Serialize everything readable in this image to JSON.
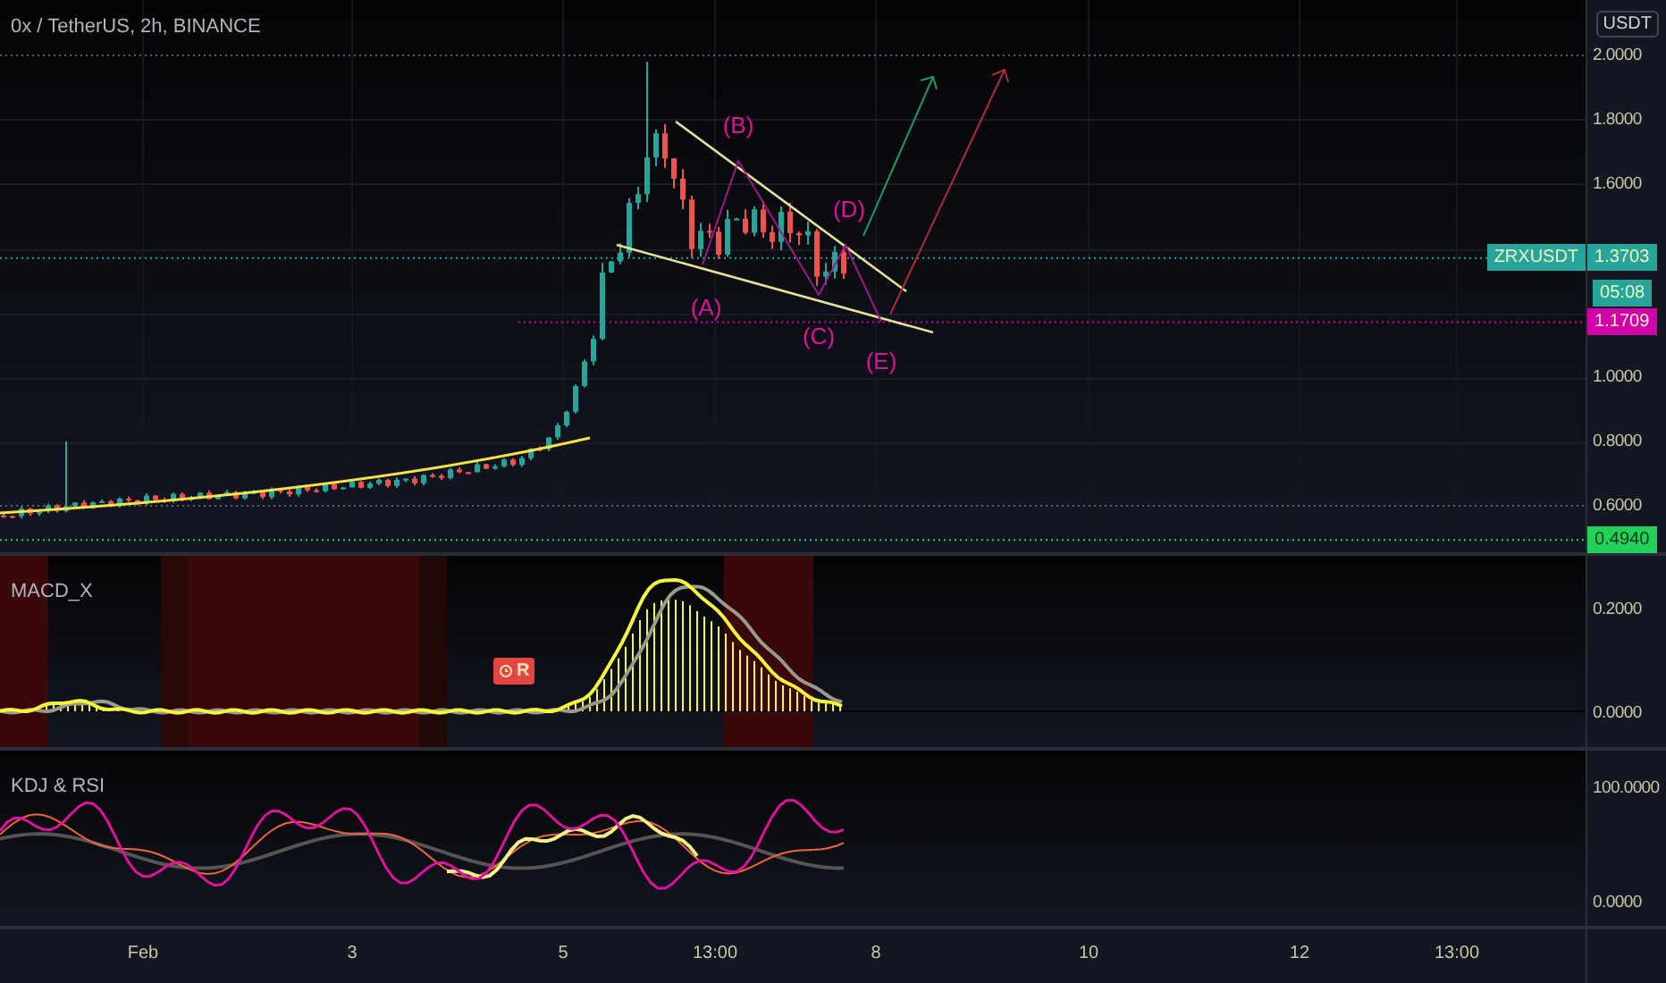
{
  "header": {
    "title": "0x / TetherUS, 2h, BINANCE"
  },
  "price_axis": {
    "currency": "USDT",
    "ticks": [
      "2.0000",
      "1.8000",
      "1.6000",
      "1.0000",
      "0.8000",
      "0.6000"
    ]
  },
  "price_labels": [
    {
      "kind": "symbol",
      "symbol": "ZRXUSDT",
      "value": "1.3703",
      "countdown": "05:08",
      "color": "#26a69a"
    },
    {
      "kind": "line",
      "value": "1.1709",
      "color": "#d100a8"
    },
    {
      "kind": "line",
      "value": "0.4940",
      "color": "#22d15a"
    }
  ],
  "wave_labels": [
    "(A)",
    "(B)",
    "(C)",
    "(D)",
    "(E)"
  ],
  "macd": {
    "title": "MACD_X",
    "ticks": [
      "0.2000",
      "0.0000"
    ],
    "signal_badge": "R"
  },
  "kdj": {
    "title": "KDJ & RSI",
    "ticks": [
      "100.0000",
      "0.0000"
    ]
  },
  "time_axis": [
    "Feb",
    "3",
    "5",
    "13:00",
    "8",
    "10",
    "12",
    "13:00"
  ]
}
